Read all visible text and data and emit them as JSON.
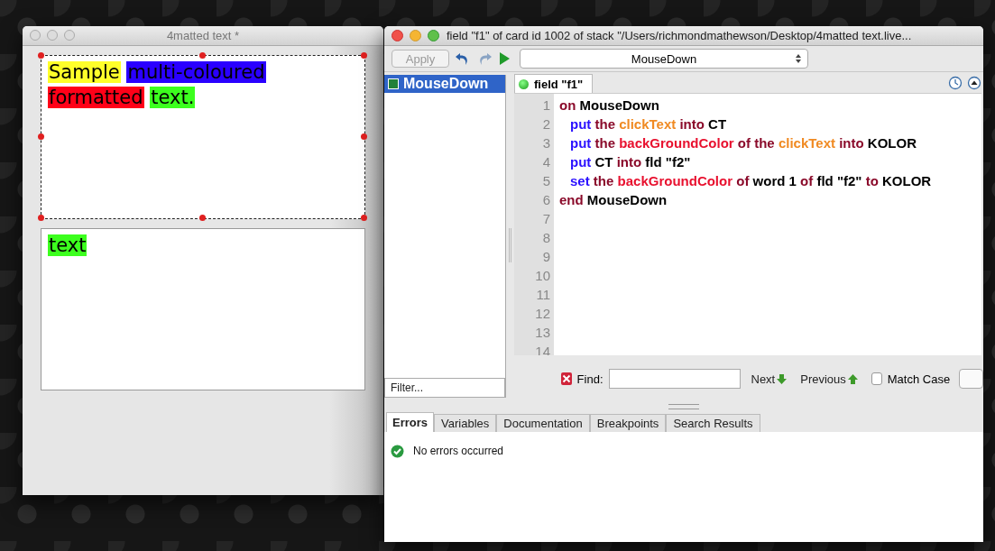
{
  "stack_window": {
    "title": "4matted text *",
    "field_1": {
      "selected": true,
      "words": [
        {
          "text": "Sample",
          "color": "#ffff2a"
        },
        {
          "text": "multi-coloured",
          "color": "#2a00ff"
        },
        {
          "text": "formatted",
          "color": "#ff0018"
        },
        {
          "text": "text.",
          "color": "#3cff1e"
        }
      ]
    },
    "field_2": {
      "words": [
        {
          "text": "text",
          "color": "#3cff1e"
        }
      ]
    }
  },
  "script_editor": {
    "title": "field \"f1\" of card id 1002 of stack \"/Users/richmondmathewson/Desktop/4matted text.live...",
    "apply_button": {
      "label": "Apply",
      "disabled": true
    },
    "handler_dropdown": {
      "value": "MouseDown"
    },
    "handlers": [
      {
        "label": "MouseDown",
        "selected": true
      }
    ],
    "filter": {
      "placeholder": "Filter..."
    },
    "tab": {
      "label": "field \"f1\""
    },
    "lines": [
      {
        "number": "1",
        "tokens": [
          {
            "text": "on",
            "kind": "keyword"
          },
          {
            "text": "MouseDown",
            "kind": "plain"
          }
        ]
      },
      {
        "number": "2",
        "tokens": [
          {
            "text": "put",
            "kind": "command"
          },
          {
            "text": "the",
            "kind": "keyword"
          },
          {
            "text": "clickText",
            "kind": "function"
          },
          {
            "text": "into",
            "kind": "keyword"
          },
          {
            "text": "CT",
            "kind": "plain"
          }
        ]
      },
      {
        "number": "3",
        "tokens": [
          {
            "text": "put",
            "kind": "command"
          },
          {
            "text": "the",
            "kind": "keyword"
          },
          {
            "text": "backGroundColor",
            "kind": "property"
          },
          {
            "text": "of",
            "kind": "keyword"
          },
          {
            "text": "the",
            "kind": "keyword"
          },
          {
            "text": "clickText",
            "kind": "function"
          },
          {
            "text": "into",
            "kind": "keyword"
          },
          {
            "text": "KOLOR",
            "kind": "plain"
          }
        ]
      },
      {
        "number": "4",
        "tokens": [
          {
            "text": "put",
            "kind": "command"
          },
          {
            "text": "CT",
            "kind": "plain"
          },
          {
            "text": "into",
            "kind": "keyword"
          },
          {
            "text": "fld \"f2\"",
            "kind": "plain"
          }
        ]
      },
      {
        "number": "5",
        "tokens": [
          {
            "text": "set",
            "kind": "command"
          },
          {
            "text": "the",
            "kind": "keyword"
          },
          {
            "text": "backGroundColor",
            "kind": "property"
          },
          {
            "text": "of",
            "kind": "keyword"
          },
          {
            "text": "word 1",
            "kind": "plain"
          },
          {
            "text": "of",
            "kind": "keyword"
          },
          {
            "text": "fld \"f2\"",
            "kind": "plain"
          },
          {
            "text": "to",
            "kind": "keyword"
          },
          {
            "text": "KOLOR",
            "kind": "plain"
          }
        ]
      },
      {
        "number": "6",
        "tokens": [
          {
            "text": "end",
            "kind": "keyword"
          },
          {
            "text": "MouseDown",
            "kind": "plain"
          }
        ]
      },
      {
        "number": "7"
      },
      {
        "number": "8"
      },
      {
        "number": "9"
      },
      {
        "number": "10"
      },
      {
        "number": "11"
      },
      {
        "number": "12"
      },
      {
        "number": "13"
      },
      {
        "number": "14"
      }
    ],
    "find": {
      "label": "Find:",
      "next": "Next",
      "previous": "Previous",
      "match_case": {
        "label": "Match Case",
        "checked": false
      }
    },
    "bottom_tabs": [
      {
        "label": "Errors",
        "selected": true
      },
      {
        "label": "Variables",
        "selected": false
      },
      {
        "label": "Documentation",
        "selected": false
      },
      {
        "label": "Breakpoints",
        "selected": false
      },
      {
        "label": "Search Results",
        "selected": false
      }
    ],
    "message": "No errors occurred"
  }
}
